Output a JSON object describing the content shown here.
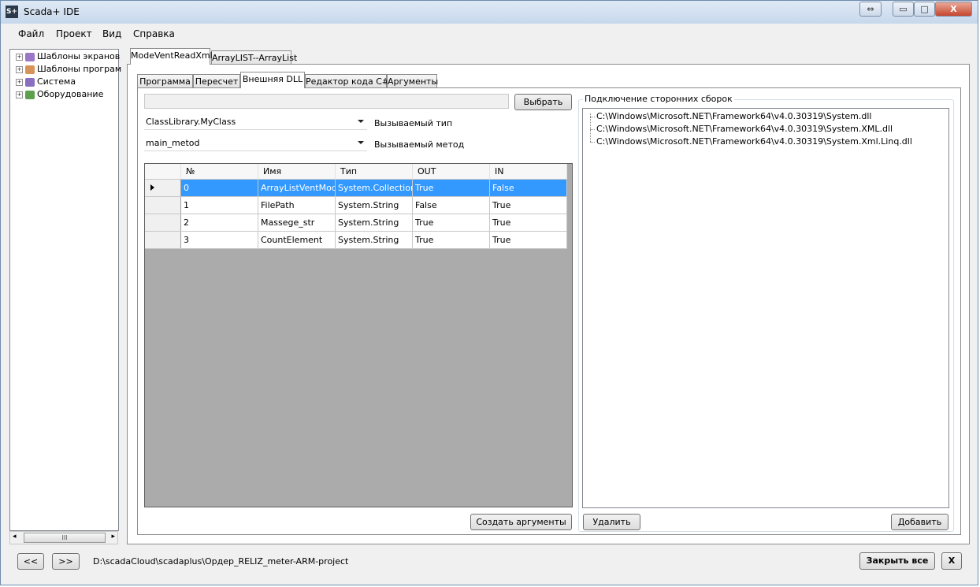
{
  "window": {
    "title": "Scada+ IDE",
    "icon_text": "S+"
  },
  "titlebar_buttons": {
    "restore": "⇔",
    "minimize": "▭",
    "maximize": "□",
    "close": "X"
  },
  "menu": [
    "Файл",
    "Проект",
    "Вид",
    "Справка"
  ],
  "tree": {
    "items": [
      {
        "label": "Шаблоны экранов",
        "icon_color": "#9b77c8"
      },
      {
        "label": "Шаблоны програм",
        "icon_color": "#d7945a"
      },
      {
        "label": "Система",
        "icon_color": "#8a6fc0"
      },
      {
        "label": "Оборудование",
        "icon_color": "#5fa04e"
      }
    ],
    "scroll_thumb": "III",
    "scroll_left": "◂",
    "scroll_right": "▸"
  },
  "doc_tabs": [
    "ModeVentReadXml",
    "ArrayLIST--ArrayList"
  ],
  "inner_tabs": [
    "Программа",
    "Пересчет",
    "Внешняя DLL",
    "Редактор кода C#",
    "Аргументы"
  ],
  "dll": {
    "path_value": "",
    "choose_button": "Выбрать",
    "type_value": "ClassLibrary.MyClass",
    "type_label": "Вызываемый тип",
    "method_value": "main_metod",
    "method_label": "Вызываемый метод",
    "create_args_button": "Создать аргументы"
  },
  "grid": {
    "columns": [
      "№",
      "Имя",
      "Тип",
      "OUT",
      "IN"
    ],
    "rows": [
      [
        "0",
        "ArrayListVentMod...",
        "System.Collection...",
        "True",
        "False"
      ],
      [
        "1",
        "FilePath",
        "System.String",
        "False",
        "True"
      ],
      [
        "2",
        "Massege_str",
        "System.String",
        "True",
        "True"
      ],
      [
        "3",
        "CountElement",
        "System.String",
        "True",
        "True"
      ]
    ],
    "selected_row": 0,
    "selection_color": "#3399ff"
  },
  "assemblies": {
    "title": "Подключение сторонних сборок",
    "items": [
      "C:\\Windows\\Microsoft.NET\\Framework64\\v4.0.30319\\System.dll",
      "C:\\Windows\\Microsoft.NET\\Framework64\\v4.0.30319\\System.XML.dll",
      "C:\\Windows\\Microsoft.NET\\Framework64\\v4.0.30319\\System.Xml.Linq.dll"
    ],
    "delete_button": "Удалить",
    "add_button": "Добавить"
  },
  "status": {
    "back_button": "<<",
    "forward_button": ">>",
    "path": "D:\\scadaCloud\\scadaplus\\Ордер_RELIZ_meter-ARM-project",
    "close_all_button": "Закрыть все",
    "close_button": "X"
  }
}
